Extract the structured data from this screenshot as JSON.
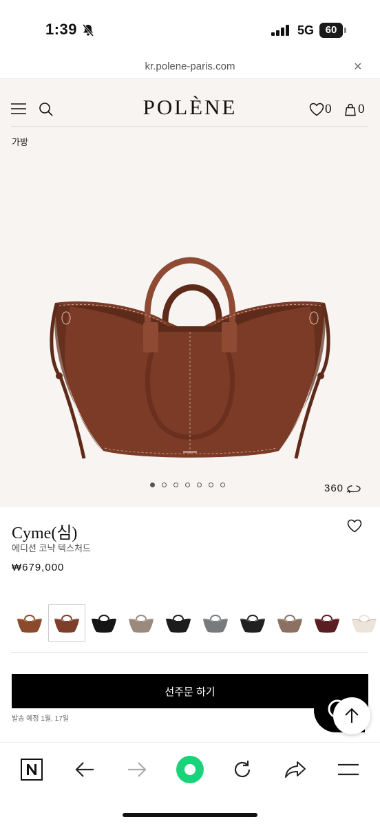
{
  "status_bar": {
    "time": "1:39",
    "network": "5G",
    "battery": "60"
  },
  "browser": {
    "url": "kr.polene-paris.com",
    "close_glyph": "×"
  },
  "header": {
    "brand": "POLÈNE",
    "wishlist_count": "0",
    "cart_count": "0"
  },
  "breadcrumb": "가방",
  "gallery": {
    "slide_count": 7,
    "active_slide": 1,
    "view360_label": "360"
  },
  "product": {
    "name": "Cyme(심)",
    "variant": "에디션 코냑 텍스처드",
    "price": "₩679,000",
    "swatches": [
      {
        "name": "cognac-smooth",
        "color": "#8a4a2b",
        "accent": "#ffffff"
      },
      {
        "name": "cognac-textured",
        "color": "#7e3e2a",
        "accent": "#ffffff"
      },
      {
        "name": "black",
        "color": "#151515",
        "accent": "#151515"
      },
      {
        "name": "taupe",
        "color": "#9b8a7c",
        "accent": "#ffffff"
      },
      {
        "name": "black-textured",
        "color": "#1c1c1c",
        "accent": "#1c1c1c"
      },
      {
        "name": "grey",
        "color": "#787a7c",
        "accent": "#ffffff"
      },
      {
        "name": "black-contrast",
        "color": "#202020",
        "accent": "#ffffff"
      },
      {
        "name": "brown-grey",
        "color": "#8c7062",
        "accent": "#ffffff"
      },
      {
        "name": "burgundy",
        "color": "#5a1d22",
        "accent": "#ffffff"
      },
      {
        "name": "ecru",
        "color": "#ece4da",
        "accent": "#8a4a2b"
      }
    ],
    "selected_swatch": 1,
    "preorder_label": "선주문 하기",
    "shipping_note": "발송 예정 1월, 17일"
  },
  "colors": {
    "bag": "#7b3b27",
    "bag_dark": "#5e2b1b",
    "bag_light": "#8e4a33",
    "stitch": "#e3c7b3",
    "page_bg": "#f7f4f1"
  }
}
